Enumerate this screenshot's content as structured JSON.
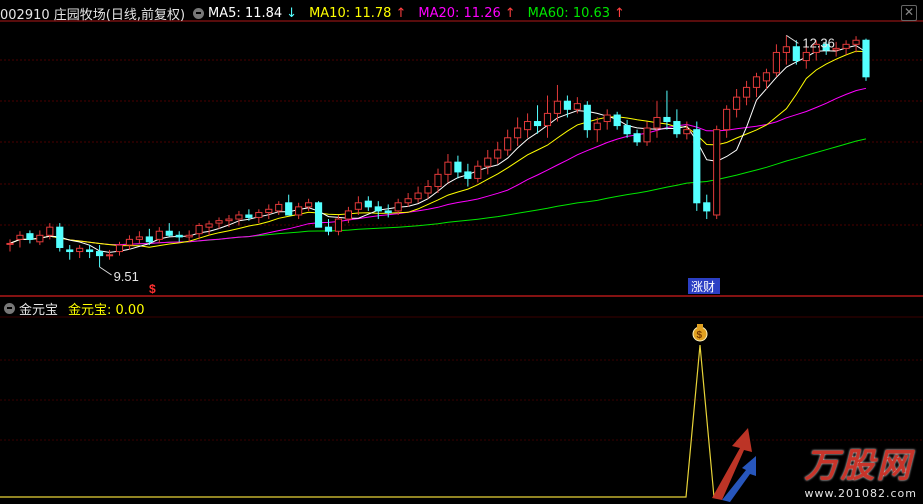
{
  "header": {
    "stock": "002910 庄园牧场(日线,前复权)",
    "ma5": {
      "label": "MA5: 11.84",
      "arrow": "↓",
      "color": "#ffffff"
    },
    "ma10": {
      "label": "MA10: 11.78",
      "arrow": "↑",
      "color": "#ffff00"
    },
    "ma20": {
      "label": "MA20: 11.26",
      "arrow": "↑",
      "color": "#ff00ff"
    },
    "ma60": {
      "label": "MA60: 10.63",
      "arrow": "↑",
      "color": "#00e600"
    }
  },
  "annotations": {
    "high": "12.36",
    "low": "9.51",
    "signal": "涨财",
    "dollar": "$",
    "bag": "$"
  },
  "indicator": {
    "name": "金元宝",
    "value_label": "金元宝: 0.00"
  },
  "watermark": {
    "title": "万股网",
    "url": "www.201082.com"
  },
  "icons": {
    "settings": "gear-icon",
    "close": "close-icon",
    "signal": "money-bag-icon"
  },
  "colors": {
    "up": "#e23a3a",
    "down": "#54ffff",
    "background": "#000000",
    "divider": "#b01818",
    "signal_line": "#e8d438"
  },
  "chart_data": {
    "type": "candlestick",
    "high": 12.36,
    "low": 9.51,
    "candles": [
      [
        9.8,
        9.85,
        9.7,
        9.8
      ],
      [
        9.85,
        9.95,
        9.75,
        9.9
      ],
      [
        9.92,
        9.96,
        9.8,
        9.85
      ],
      [
        9.82,
        9.96,
        9.78,
        9.9
      ],
      [
        9.9,
        10.05,
        9.85,
        10.0
      ],
      [
        10.0,
        10.05,
        9.7,
        9.75
      ],
      [
        9.72,
        9.78,
        9.6,
        9.7
      ],
      [
        9.7,
        9.78,
        9.62,
        9.74
      ],
      [
        9.72,
        9.78,
        9.62,
        9.7
      ],
      [
        9.7,
        9.78,
        9.51,
        9.65
      ],
      [
        9.65,
        9.72,
        9.6,
        9.66
      ],
      [
        9.7,
        9.82,
        9.65,
        9.78
      ],
      [
        9.78,
        9.9,
        9.72,
        9.85
      ],
      [
        9.85,
        9.95,
        9.8,
        9.88
      ],
      [
        9.88,
        9.98,
        9.78,
        9.82
      ],
      [
        9.85,
        10.0,
        9.8,
        9.95
      ],
      [
        9.95,
        10.05,
        9.88,
        9.9
      ],
      [
        9.9,
        9.95,
        9.82,
        9.88
      ],
      [
        9.88,
        9.96,
        9.82,
        9.9
      ],
      [
        9.92,
        10.05,
        9.85,
        10.02
      ],
      [
        10.0,
        10.08,
        9.9,
        10.04
      ],
      [
        10.05,
        10.12,
        9.98,
        10.08
      ],
      [
        10.08,
        10.15,
        10.0,
        10.1
      ],
      [
        10.1,
        10.2,
        10.02,
        10.15
      ],
      [
        10.15,
        10.22,
        10.08,
        10.12
      ],
      [
        10.12,
        10.22,
        10.05,
        10.18
      ],
      [
        10.18,
        10.28,
        10.1,
        10.22
      ],
      [
        10.2,
        10.32,
        10.15,
        10.28
      ],
      [
        10.3,
        10.4,
        10.2,
        10.15
      ],
      [
        10.15,
        10.3,
        10.1,
        10.25
      ],
      [
        10.25,
        10.35,
        10.2,
        10.3
      ],
      [
        10.3,
        10.32,
        10.1,
        10.0
      ],
      [
        10.0,
        10.1,
        9.9,
        9.95
      ],
      [
        9.95,
        10.15,
        9.9,
        10.1
      ],
      [
        10.1,
        10.25,
        10.05,
        10.2
      ],
      [
        10.22,
        10.38,
        10.15,
        10.3
      ],
      [
        10.32,
        10.38,
        10.2,
        10.25
      ],
      [
        10.25,
        10.32,
        10.1,
        10.2
      ],
      [
        10.2,
        10.28,
        10.12,
        10.18
      ],
      [
        10.2,
        10.35,
        10.15,
        10.3
      ],
      [
        10.3,
        10.42,
        10.25,
        10.35
      ],
      [
        10.35,
        10.5,
        10.3,
        10.42
      ],
      [
        10.42,
        10.58,
        10.35,
        10.5
      ],
      [
        10.5,
        10.72,
        10.42,
        10.65
      ],
      [
        10.65,
        10.9,
        10.55,
        10.8
      ],
      [
        10.8,
        10.88,
        10.6,
        10.68
      ],
      [
        10.68,
        10.78,
        10.5,
        10.6
      ],
      [
        10.6,
        10.82,
        10.55,
        10.75
      ],
      [
        10.75,
        10.95,
        10.65,
        10.85
      ],
      [
        10.85,
        11.05,
        10.78,
        10.95
      ],
      [
        10.95,
        11.2,
        10.88,
        11.1
      ],
      [
        11.1,
        11.35,
        11.0,
        11.22
      ],
      [
        11.2,
        11.4,
        11.1,
        11.3
      ],
      [
        11.3,
        11.5,
        11.15,
        11.25
      ],
      [
        11.25,
        11.62,
        11.1,
        11.4
      ],
      [
        11.4,
        11.75,
        11.3,
        11.55
      ],
      [
        11.55,
        11.62,
        11.35,
        11.45
      ],
      [
        11.45,
        11.6,
        11.4,
        11.52
      ],
      [
        11.5,
        11.55,
        11.1,
        11.2
      ],
      [
        11.2,
        11.35,
        11.05,
        11.28
      ],
      [
        11.3,
        11.45,
        11.2,
        11.38
      ],
      [
        11.38,
        11.42,
        11.2,
        11.25
      ],
      [
        11.25,
        11.32,
        11.1,
        11.15
      ],
      [
        11.15,
        11.2,
        11.0,
        11.05
      ],
      [
        11.05,
        11.3,
        11.0,
        11.22
      ],
      [
        11.22,
        11.55,
        11.1,
        11.35
      ],
      [
        11.35,
        11.68,
        11.2,
        11.3
      ],
      [
        11.3,
        11.45,
        11.1,
        11.15
      ],
      [
        11.15,
        11.3,
        11.08,
        11.2
      ],
      [
        11.2,
        11.3,
        10.2,
        10.3
      ],
      [
        10.3,
        10.4,
        10.1,
        10.2
      ],
      [
        10.15,
        11.25,
        10.1,
        11.2
      ],
      [
        11.2,
        11.5,
        11.1,
        11.45
      ],
      [
        11.45,
        11.7,
        11.35,
        11.6
      ],
      [
        11.6,
        11.8,
        11.5,
        11.72
      ],
      [
        11.72,
        11.9,
        11.6,
        11.85
      ],
      [
        11.8,
        11.95,
        11.7,
        11.9
      ],
      [
        11.9,
        12.25,
        11.85,
        12.15
      ],
      [
        12.15,
        12.36,
        12.0,
        12.22
      ],
      [
        12.22,
        12.3,
        12.0,
        12.05
      ],
      [
        12.05,
        12.25,
        11.95,
        12.15
      ],
      [
        12.15,
        12.3,
        12.05,
        12.25
      ],
      [
        12.25,
        12.3,
        12.12,
        12.18
      ],
      [
        12.18,
        12.28,
        12.1,
        12.2
      ],
      [
        12.2,
        12.3,
        12.12,
        12.25
      ],
      [
        12.25,
        12.35,
        12.15,
        12.3
      ],
      [
        12.3,
        12.32,
        11.8,
        11.85
      ]
    ],
    "ma": [
      {
        "name": "MA5",
        "value": 11.84
      },
      {
        "name": "MA10",
        "value": 11.78
      },
      {
        "name": "MA20",
        "value": 11.26
      },
      {
        "name": "MA60",
        "value": 10.63
      }
    ]
  }
}
